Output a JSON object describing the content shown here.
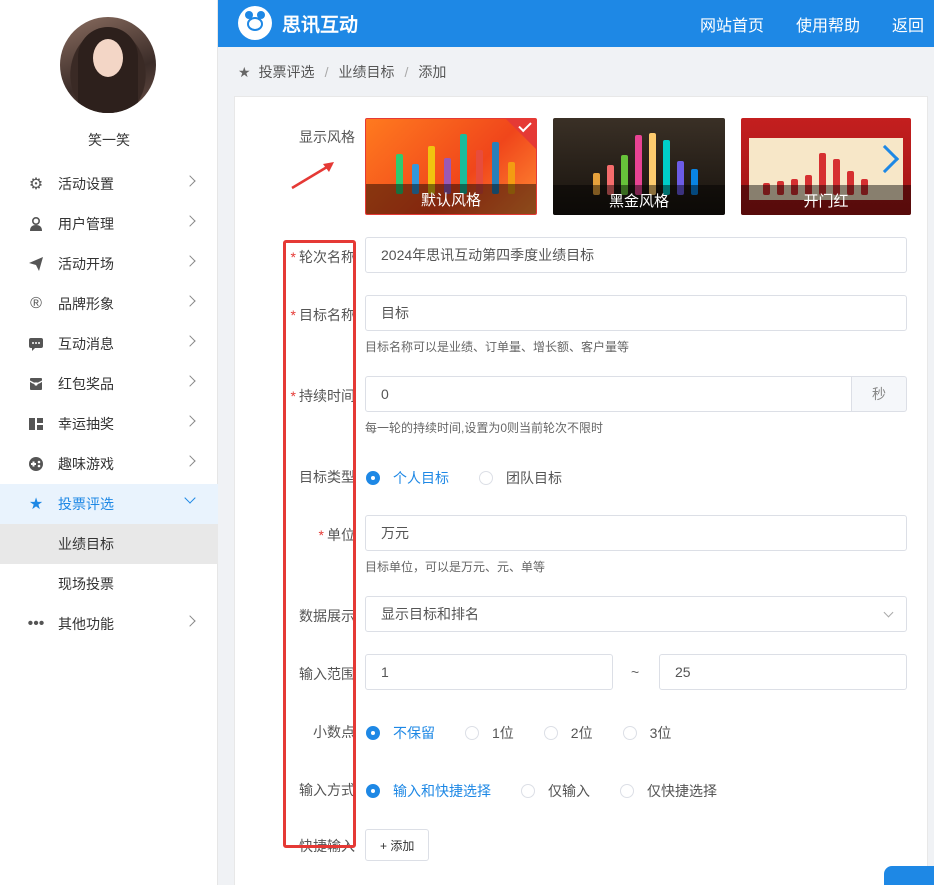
{
  "app": {
    "brand": "思讯互动"
  },
  "header": {
    "nav": [
      "网站首页",
      "使用帮助",
      "返回"
    ]
  },
  "user": {
    "name": "笑一笑"
  },
  "sidebar": {
    "items": [
      {
        "label": "活动设置",
        "icon": "gear-icon"
      },
      {
        "label": "用户管理",
        "icon": "user-icon"
      },
      {
        "label": "活动开场",
        "icon": "paper-plane-icon"
      },
      {
        "label": "品牌形象",
        "icon": "registered-icon"
      },
      {
        "label": "互动消息",
        "icon": "message-icon"
      },
      {
        "label": "红包奖品",
        "icon": "red-packet-icon"
      },
      {
        "label": "幸运抽奖",
        "icon": "lottery-icon"
      },
      {
        "label": "趣味游戏",
        "icon": "gamepad-icon"
      },
      {
        "label": "投票评选",
        "icon": "star-icon"
      },
      {
        "label": "其他功能",
        "icon": "more-icon"
      }
    ],
    "sub_items": [
      "业绩目标",
      "现场投票"
    ]
  },
  "breadcrumb": [
    "投票评选",
    "业绩目标",
    "添加"
  ],
  "form": {
    "style": {
      "label": "显示风格",
      "options": [
        "默认风格",
        "黑金风格",
        "开门红"
      ]
    },
    "round_name": {
      "label": "轮次名称",
      "value": "2024年思讯互动第四季度业绩目标"
    },
    "target_name": {
      "label": "目标名称",
      "value": "目标",
      "hint": "目标名称可以是业绩、订单量、增长额、客户量等"
    },
    "duration": {
      "label": "持续时间",
      "value": "0",
      "unit": "秒",
      "hint": "每一轮的持续时间,设置为0则当前轮次不限时"
    },
    "target_type": {
      "label": "目标类型",
      "options": [
        "个人目标",
        "团队目标"
      ]
    },
    "unit": {
      "label": "单位",
      "value": "万元",
      "hint": "目标单位，可以是万元、元、单等"
    },
    "display": {
      "label": "数据展示",
      "value": "显示目标和排名"
    },
    "range": {
      "label": "输入范围",
      "min": "1",
      "tilde": "~",
      "max": "25"
    },
    "decimal": {
      "label": "小数点",
      "options": [
        "不保留",
        "1位",
        "2位",
        "3位"
      ]
    },
    "input_mode": {
      "label": "输入方式",
      "options": [
        "输入和快捷选择",
        "仅输入",
        "仅快捷选择"
      ]
    },
    "quick_input": {
      "label": "快捷输入",
      "add_label": "+ 添加"
    }
  },
  "colors": {
    "primary": "#1e88e5",
    "highlight": "#e53935"
  }
}
